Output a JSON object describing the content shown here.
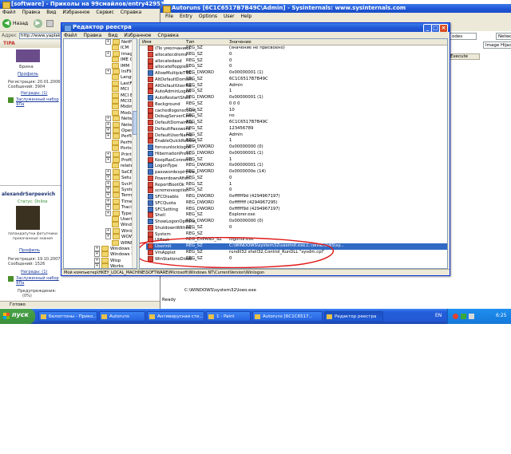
{
  "forum": {
    "title": "[software] - Приколы на 99смайлов/entry4295343/entry4295343",
    "menu": [
      "Файл",
      "Правка",
      "Вид",
      "Избранное",
      "Сервис",
      "Справка"
    ],
    "back_label": "Назад",
    "address_label": "Адрес",
    "address_value": "http://www.yaplakal",
    "user1": {
      "name": "Брина",
      "profile_link": "Профиль",
      "registered": "Регистрация: 20.01.2006",
      "messages": "Сообщений: 3904",
      "awards": "Награды: (1)",
      "award_text": "Заслуженный набор ЯПа"
    },
    "user2": {
      "name": "alexandrSerpeevich",
      "status": "Статус: Online",
      "caption": "папандапутни фотупчики прокачанные знания",
      "profile_link": "Профиль",
      "registered": "Регистрация: 19.10.2007",
      "messages": "Сообщений: 1526",
      "awards": "Награды: (1)",
      "award_text": "Заслуженный набор ЯПа",
      "warnings": "Предупреждения:",
      "warn_value": "(0%)"
    },
    "status_text": "Готово"
  },
  "autoruns": {
    "title": "Autoruns [6C1C6517B7B49C\\Admin] - Sysinternals: www.sysinternals.com",
    "menu": [
      "File",
      "Entry",
      "Options",
      "User",
      "Help"
    ],
    "tabs": [
      "odes",
      "Netwo",
      "Image Hijacks"
    ],
    "execute_label": "Execute",
    "path_text": "C:\\WINDOWS\\system32\\loeo.exe",
    "ready_text": "Ready"
  },
  "regedit": {
    "title": "Редактор реестра",
    "menu": [
      "Файл",
      "Правка",
      "Вид",
      "Избранное",
      "Справка"
    ],
    "tree_items": [
      {
        "label": "NetPo",
        "type": "plus",
        "indent": 2
      },
      {
        "label": "ICM",
        "type": "folder",
        "indent": 2
      },
      {
        "label": "Image F",
        "type": "plus",
        "indent": 2
      },
      {
        "label": "IME Co",
        "type": "folder",
        "indent": 2
      },
      {
        "label": "IMM",
        "type": "folder",
        "indent": 2
      },
      {
        "label": "IniFileMa",
        "type": "plus",
        "indent": 2
      },
      {
        "label": "Languag",
        "type": "folder",
        "indent": 2
      },
      {
        "label": "LastFon",
        "type": "folder",
        "indent": 2
      },
      {
        "label": "MCI",
        "type": "folder",
        "indent": 2
      },
      {
        "label": "MCI Ext",
        "type": "folder",
        "indent": 2
      },
      {
        "label": "MCI32",
        "type": "folder",
        "indent": 2
      },
      {
        "label": "Midimap",
        "type": "folder",
        "indent": 2
      },
      {
        "label": "ModuleC",
        "type": "folder",
        "indent": 2
      },
      {
        "label": "Network",
        "type": "plus",
        "indent": 2
      },
      {
        "label": "Network",
        "type": "plus",
        "indent": 2
      },
      {
        "label": "OpenGL",
        "type": "plus",
        "indent": 2
      },
      {
        "label": "Perflib",
        "type": "plus",
        "indent": 2
      },
      {
        "label": "PerHwlc",
        "type": "folder",
        "indent": 2
      },
      {
        "label": "Ports",
        "type": "folder",
        "indent": 2
      },
      {
        "label": "Print",
        "type": "plus",
        "indent": 2
      },
      {
        "label": "ProfileLis",
        "type": "plus",
        "indent": 2
      },
      {
        "label": "related.",
        "type": "folder",
        "indent": 2
      },
      {
        "label": "SeCEdit",
        "type": "plus",
        "indent": 2
      },
      {
        "label": "Setup",
        "type": "plus",
        "indent": 2
      },
      {
        "label": "SvcHost",
        "type": "plus",
        "indent": 2
      },
      {
        "label": "SystemR",
        "type": "plus",
        "indent": 2
      },
      {
        "label": "Termina",
        "type": "plus",
        "indent": 2
      },
      {
        "label": "Time Zo",
        "type": "plus",
        "indent": 2
      },
      {
        "label": "Tracing",
        "type": "plus",
        "indent": 2
      },
      {
        "label": "Type 1 I",
        "type": "plus",
        "indent": 2
      },
      {
        "label": "Userinst",
        "type": "folder",
        "indent": 2
      },
      {
        "label": "Window:",
        "type": "folder",
        "indent": 2
      },
      {
        "label": "Winlogo",
        "type": "plus",
        "indent": 2
      },
      {
        "label": "WOW",
        "type": "plus",
        "indent": 2
      },
      {
        "label": "WPAEve",
        "type": "folder",
        "indent": 2
      },
      {
        "label": "Windows Script",
        "type": "plus",
        "indent": 1
      },
      {
        "label": "Windows Scripti",
        "type": "plus",
        "indent": 1
      },
      {
        "label": "Wisp",
        "type": "plus",
        "indent": 1
      },
      {
        "label": "Works",
        "type": "plus",
        "indent": 1
      }
    ],
    "columns": [
      "Имя",
      "Тип",
      "Значение"
    ],
    "values": [
      {
        "name": "(По умолчанию)",
        "type": "REG_SZ",
        "data": "(значение не присвоено)",
        "kind": "sz"
      },
      {
        "name": "allocatecdroms",
        "type": "REG_SZ",
        "data": "0",
        "kind": "sz"
      },
      {
        "name": "allocatedasd",
        "type": "REG_SZ",
        "data": "0",
        "kind": "sz"
      },
      {
        "name": "allocatefloppies",
        "type": "REG_SZ",
        "data": "0",
        "kind": "sz"
      },
      {
        "name": "AllowMultipleTSS...",
        "type": "REG_DWORD",
        "data": "0x00000001 (1)",
        "kind": "dw"
      },
      {
        "name": "AltDefaultDomain...",
        "type": "REG_SZ",
        "data": "6C1C6517B7B49C",
        "kind": "sz"
      },
      {
        "name": "AltDefaultUserNa...",
        "type": "REG_SZ",
        "data": "Admin",
        "kind": "sz"
      },
      {
        "name": "AutoAdminLogon",
        "type": "REG_SZ",
        "data": "1",
        "kind": "sz"
      },
      {
        "name": "AutoRestartShell",
        "type": "REG_DWORD",
        "data": "0x00000001 (1)",
        "kind": "dw"
      },
      {
        "name": "Background",
        "type": "REG_SZ",
        "data": "0 0 0",
        "kind": "sz"
      },
      {
        "name": "cachedlogonscount",
        "type": "REG_SZ",
        "data": "10",
        "kind": "sz"
      },
      {
        "name": "DebugServerCom...",
        "type": "REG_SZ",
        "data": "no",
        "kind": "sz"
      },
      {
        "name": "DefaultDomainNa...",
        "type": "REG_SZ",
        "data": "6C1C6517B7B49C",
        "kind": "sz"
      },
      {
        "name": "DefaultPassword",
        "type": "REG_SZ",
        "data": "123456789",
        "kind": "sz"
      },
      {
        "name": "DefaultUserName",
        "type": "REG_SZ",
        "data": "Admin",
        "kind": "sz"
      },
      {
        "name": "EnableQuickReboot",
        "type": "REG_SZ",
        "data": "1",
        "kind": "sz"
      },
      {
        "name": "forceunlocklogon",
        "type": "REG_DWORD",
        "data": "0x00000000 (0)",
        "kind": "dw"
      },
      {
        "name": "HibernationPrevi...",
        "type": "REG_DWORD",
        "data": "0x00000001 (1)",
        "kind": "dw"
      },
      {
        "name": "KeepRasConnecti...",
        "type": "REG_SZ",
        "data": "1",
        "kind": "sz"
      },
      {
        "name": "LogonType",
        "type": "REG_DWORD",
        "data": "0x00000001 (1)",
        "kind": "dw"
      },
      {
        "name": "passwordexpirywa...",
        "type": "REG_DWORD",
        "data": "0x0000000e (14)",
        "kind": "dw"
      },
      {
        "name": "PowerdownAfter...",
        "type": "REG_SZ",
        "data": "0",
        "kind": "sz"
      },
      {
        "name": "ReportBootOk",
        "type": "REG_SZ",
        "data": "1",
        "kind": "sz"
      },
      {
        "name": "scremoveoption",
        "type": "REG_SZ",
        "data": "0",
        "kind": "sz"
      },
      {
        "name": "SFCDisable",
        "type": "REG_DWORD",
        "data": "0xffffff9d (4294967197)",
        "kind": "dw"
      },
      {
        "name": "SFCQuota",
        "type": "REG_DWORD",
        "data": "0xffffffff (4294967295)",
        "kind": "dw"
      },
      {
        "name": "SFCSetting",
        "type": "REG_DWORD",
        "data": "0xffffff9d (4294967197)",
        "kind": "dw"
      },
      {
        "name": "Shell",
        "type": "REG_SZ",
        "data": "Explorer.exe",
        "kind": "sz"
      },
      {
        "name": "ShowLogonOptions",
        "type": "REG_DWORD",
        "data": "0x00000000 (0)",
        "kind": "dw"
      },
      {
        "name": "ShutdownWithou...",
        "type": "REG_SZ",
        "data": "0",
        "kind": "sz"
      },
      {
        "name": "System",
        "type": "REG_SZ",
        "data": "",
        "kind": "sz"
      },
      {
        "name": "UIHost",
        "type": "REG_EXPAND_SZ",
        "data": "logonui.exe",
        "kind": "sz"
      },
      {
        "name": "Userinit",
        "type": "REG_SZ",
        "data": "C:\\WINDOWS\\system32\\userinit.exe,C:\\WINDOWS\\sy...",
        "kind": "sz"
      },
      {
        "name": "VmApplet",
        "type": "REG_SZ",
        "data": "rundll32 shell32,Control_RunDLL \"sysdm.cpl\"",
        "kind": "sz"
      },
      {
        "name": "WinStationsDisab...",
        "type": "REG_SZ",
        "data": "0",
        "kind": "sz"
      }
    ],
    "selected_index": 32,
    "status_path": "Мой компьютер\\HKEY_LOCAL_MACHINE\\SOFTWARE\\Microsoft\\Windows NT\\CurrentVersion\\Winlogon",
    "highlight_color": "#e01818"
  },
  "taskbar": {
    "start_label": "пуск",
    "buttons": [
      {
        "label": "Белоптоны - Прико...",
        "active": false
      },
      {
        "label": "Autoruns",
        "active": false
      },
      {
        "label": "Антивирусная сте...",
        "active": false
      },
      {
        "label": "1 - Paint",
        "active": false
      },
      {
        "label": "Autoruns [6C1C6517...",
        "active": false
      },
      {
        "label": "Редактор реестра",
        "active": true
      }
    ],
    "lang": "EN",
    "clock": "6:25"
  }
}
